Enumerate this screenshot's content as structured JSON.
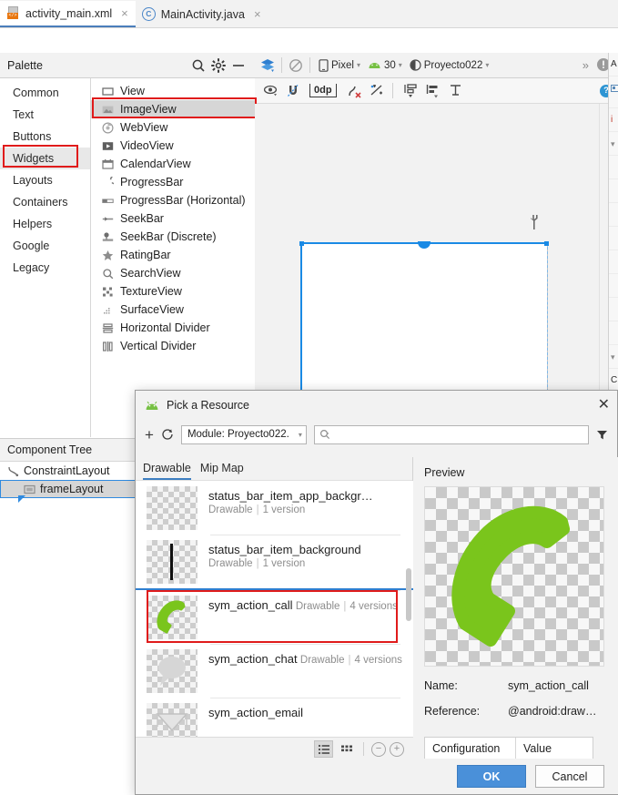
{
  "tabs": [
    {
      "label": "activity_main.xml",
      "icon": "xml-file-icon",
      "active": true,
      "close": "×"
    },
    {
      "label": "MainActivity.java",
      "icon": "java-class-icon",
      "active": false,
      "close": "×"
    }
  ],
  "palette": {
    "title": "Palette",
    "icons": [
      "search-icon",
      "gear-icon",
      "minimize-icon"
    ],
    "categories": [
      {
        "label": "Common",
        "selected": false
      },
      {
        "label": "Text",
        "selected": false
      },
      {
        "label": "Buttons",
        "selected": false
      },
      {
        "label": "Widgets",
        "selected": true
      },
      {
        "label": "Layouts",
        "selected": false
      },
      {
        "label": "Containers",
        "selected": false
      },
      {
        "label": "Helpers",
        "selected": false
      },
      {
        "label": "Google",
        "selected": false
      },
      {
        "label": "Legacy",
        "selected": false
      }
    ],
    "items": [
      {
        "label": "View",
        "icon": "view-rect-icon",
        "selected": false
      },
      {
        "label": "ImageView",
        "icon": "image-view-icon",
        "selected": true
      },
      {
        "label": "WebView",
        "icon": "web-view-icon",
        "selected": false
      },
      {
        "label": "VideoView",
        "icon": "video-play-icon",
        "selected": false
      },
      {
        "label": "CalendarView",
        "icon": "calendar-icon",
        "selected": false
      },
      {
        "label": "ProgressBar",
        "icon": "progress-circular-icon",
        "selected": false
      },
      {
        "label": "ProgressBar (Horizontal)",
        "icon": "progress-horizontal-icon",
        "selected": false
      },
      {
        "label": "SeekBar",
        "icon": "seekbar-icon",
        "selected": false
      },
      {
        "label": "SeekBar (Discrete)",
        "icon": "seekbar-discrete-icon",
        "selected": false
      },
      {
        "label": "RatingBar",
        "icon": "star-icon",
        "selected": false
      },
      {
        "label": "SearchView",
        "icon": "search-icon",
        "selected": false
      },
      {
        "label": "TextureView",
        "icon": "texture-view-icon",
        "selected": false
      },
      {
        "label": "SurfaceView",
        "icon": "surface-view-icon",
        "selected": false
      },
      {
        "label": "Horizontal Divider",
        "icon": "horizontal-divider-icon",
        "selected": false
      },
      {
        "label": "Vertical Divider",
        "icon": "vertical-divider-icon",
        "selected": false
      }
    ]
  },
  "design_toolbar": {
    "layers_label": "",
    "device": "Pixel",
    "api_level": "30",
    "theme": "Proyecto022",
    "overflow": "»",
    "warning_icon": "warning-circle-icon",
    "blueprint_icon": "blueprint-toggle-icon",
    "no_preview_icon": "disable-render-icon"
  },
  "design_toolbar2": {
    "eye_label": "show-constraints-icon",
    "magnet_label": "autoconnect-off-icon",
    "margin_value": "0dp",
    "clear_constraints_icon": "clear-constraints-icon",
    "infer_constraints_icon": "infer-constraints-icon",
    "pack_icon": "pack-icon",
    "align_icon": "align-icon",
    "guidelines_icon": "guidelines-icon",
    "help_icon": "help-icon"
  },
  "component_tree": {
    "title": "Component Tree",
    "rows": [
      {
        "label": "ConstraintLayout",
        "icon": "constraint-layout-icon",
        "level": 0,
        "selected": false
      },
      {
        "label": "frameLayout",
        "icon": "frame-layout-icon",
        "level": 1,
        "selected": true
      }
    ]
  },
  "attributes_sliver": {
    "title_fragment": "A",
    "rows": [
      "",
      "i",
      "",
      "",
      "",
      "",
      "",
      "",
      "",
      "",
      "C"
    ]
  },
  "dialog": {
    "title": "Pick a Resource",
    "title_icon": "android-head-icon",
    "close_label": "✕",
    "toolbar": {
      "add_label": "+",
      "refresh_icon": "refresh-icon",
      "module_label": "Module: Proyecto022.",
      "search_value": "",
      "search_placeholder": "",
      "search_icon": "search-icon",
      "filter_icon": "filter-icon"
    },
    "tabs": [
      {
        "label": "Drawable",
        "active": true
      },
      {
        "label": "Mip Map",
        "active": false
      }
    ],
    "resources": [
      {
        "name": "status_bar_item_app_backgr…",
        "type": "Drawable",
        "versions": "1 version",
        "selected": false,
        "glyph": "none"
      },
      {
        "name": "status_bar_item_background",
        "type": "Drawable",
        "versions": "1 version",
        "selected": false,
        "glyph": "vertical-bar"
      },
      {
        "name": "sym_action_call",
        "type": "Drawable",
        "versions": "4 versions",
        "selected": true,
        "glyph": "phone-green"
      },
      {
        "name": "sym_action_chat",
        "type": "Drawable",
        "versions": "4 versions",
        "selected": false,
        "glyph": "chat-bubble"
      },
      {
        "name": "sym_action_email",
        "type": "Drawable",
        "versions": "",
        "selected": false,
        "glyph": "envelope"
      }
    ],
    "footer": {
      "list_view_icon": "list-view-icon",
      "grid_view_icon": "grid-view-icon",
      "zoom_out_icon": "zoom-out-icon",
      "zoom_in_icon": "zoom-in-icon",
      "zoom_out_label": "−",
      "zoom_in_label": "+"
    },
    "preview": {
      "label": "Preview",
      "image_glyph": "phone-receiver-green",
      "name_key": "Name:",
      "name_value": "sym_action_call",
      "reference_key": "Reference:",
      "reference_value": "@android:draw…",
      "config_header": "Configuration",
      "value_header": "Value"
    },
    "buttons": {
      "ok": "OK",
      "cancel": "Cancel"
    }
  },
  "colors": {
    "accent_blue": "#4a90d9",
    "selection_blue": "#1a8ae5",
    "highlight_red": "#e01b1b",
    "android_green": "#76c043",
    "icon_green": "#7ac51c",
    "panel_bg": "#f2f2f2"
  }
}
